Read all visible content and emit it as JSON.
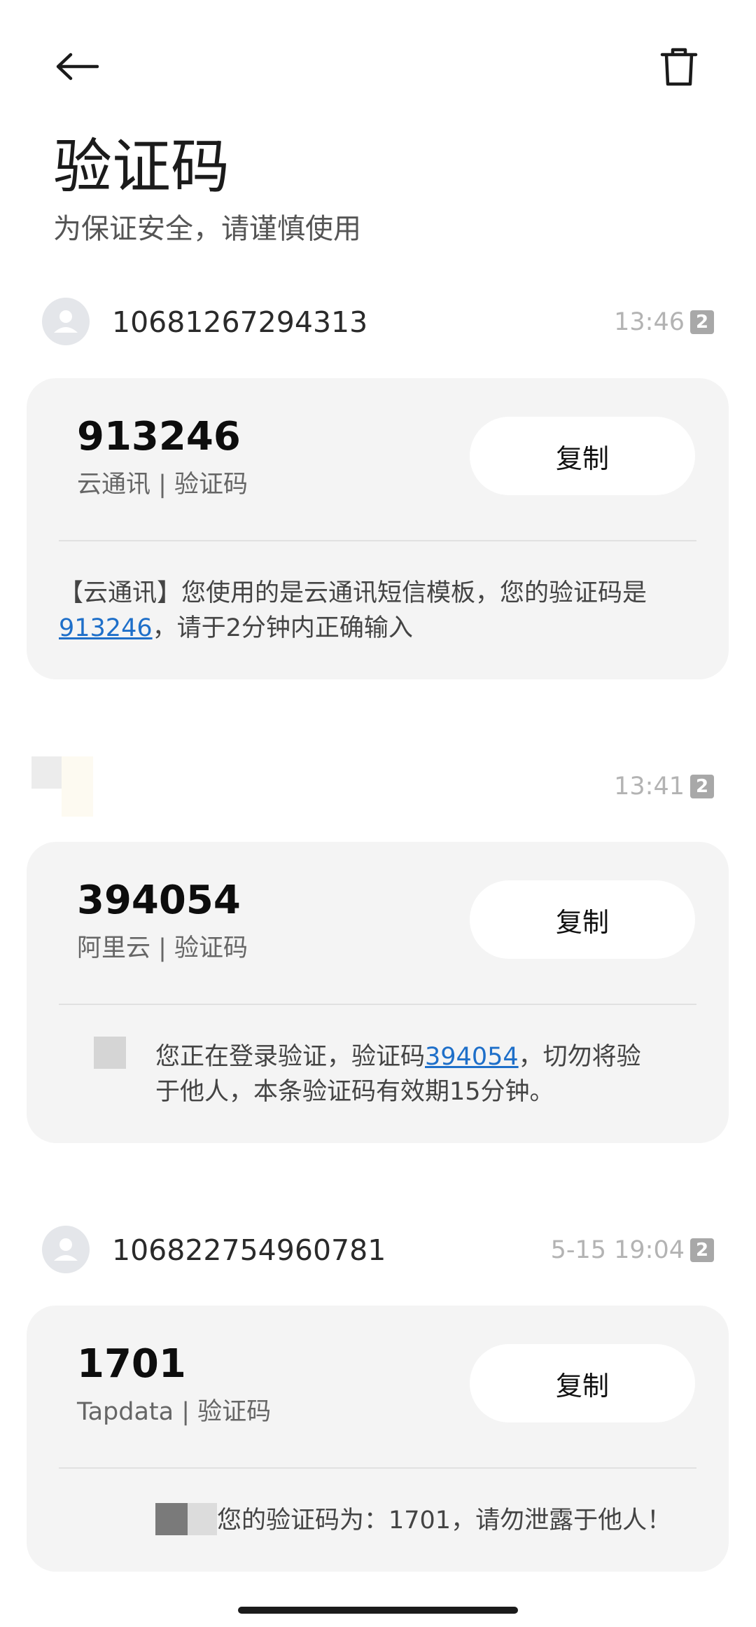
{
  "header": {
    "title": "验证码",
    "subtitle": "为保证安全，请谨慎使用"
  },
  "messages": [
    {
      "sender": "10681267294313",
      "time": "13:46",
      "sim": "2",
      "code": "913246",
      "source": "云通讯 | 验证码",
      "copy_label": "复制",
      "body_line1": "【云通讯】您使用的是云通讯短信模板，您的验证码是",
      "body_code": "913246",
      "body_line2": "，请于2分钟内正确输入"
    },
    {
      "sender": "",
      "time": "13:41",
      "sim": "2",
      "code": "394054",
      "source": "阿里云 | 验证码",
      "copy_label": "复制",
      "body_prefix": "您正在登录验证，验证码",
      "body_code": "394054",
      "body_suffix": "，切勿将验",
      "body_line2": "于他人，本条验证码有效期15分钟。"
    },
    {
      "sender": "106822754960781",
      "time": "5-15 19:04",
      "sim": "2",
      "code": "1701",
      "source": "Tapdata | 验证码",
      "copy_label": "复制",
      "body": "您的验证码为：1701，请勿泄露于他人！"
    }
  ],
  "icons": {
    "back": "arrow-left-icon",
    "delete": "trash-icon",
    "avatar": "person-icon"
  }
}
